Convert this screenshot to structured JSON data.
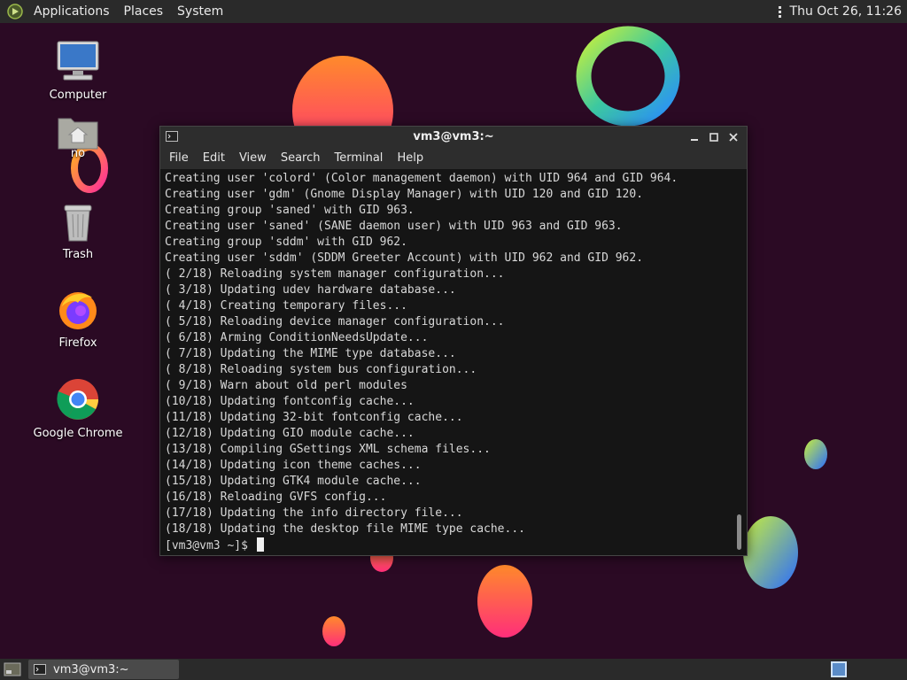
{
  "top_panel": {
    "applications": "Applications",
    "places": "Places",
    "system": "System",
    "clock": "Thu Oct 26, 11:26"
  },
  "desktop": {
    "icons": [
      {
        "label": "Computer",
        "icon": "computer-icon"
      },
      {
        "label": "no",
        "icon": "home-folder-icon"
      },
      {
        "label": "Trash",
        "icon": "trash-icon"
      },
      {
        "label": "Firefox",
        "icon": "firefox-icon"
      },
      {
        "label": "Google Chrome",
        "icon": "chrome-icon"
      }
    ]
  },
  "terminal": {
    "title": "vm3@vm3:~",
    "menu": [
      "File",
      "Edit",
      "View",
      "Search",
      "Terminal",
      "Help"
    ],
    "lines": [
      "Creating user 'colord' (Color management daemon) with UID 964 and GID 964.",
      "Creating user 'gdm' (Gnome Display Manager) with UID 120 and GID 120.",
      "Creating group 'saned' with GID 963.",
      "Creating user 'saned' (SANE daemon user) with UID 963 and GID 963.",
      "Creating group 'sddm' with GID 962.",
      "Creating user 'sddm' (SDDM Greeter Account) with UID 962 and GID 962.",
      "( 2/18) Reloading system manager configuration...",
      "( 3/18) Updating udev hardware database...",
      "( 4/18) Creating temporary files...",
      "( 5/18) Reloading device manager configuration...",
      "( 6/18) Arming ConditionNeedsUpdate...",
      "( 7/18) Updating the MIME type database...",
      "( 8/18) Reloading system bus configuration...",
      "( 9/18) Warn about old perl modules",
      "(10/18) Updating fontconfig cache...",
      "(11/18) Updating 32-bit fontconfig cache...",
      "(12/18) Updating GIO module cache...",
      "(13/18) Compiling GSettings XML schema files...",
      "(14/18) Updating icon theme caches...",
      "(15/18) Updating GTK4 module cache...",
      "(16/18) Reloading GVFS config...",
      "(17/18) Updating the info directory file...",
      "(18/18) Updating the desktop file MIME type cache..."
    ],
    "prompt": "[vm3@vm3 ~]$ "
  },
  "bottom_panel": {
    "task_label": "vm3@vm3:~"
  },
  "colors": {
    "background": "#2b0a24",
    "panel": "#2a2a2a",
    "terminal_bg": "#151515",
    "workspace_active": "#5a8cc8"
  }
}
